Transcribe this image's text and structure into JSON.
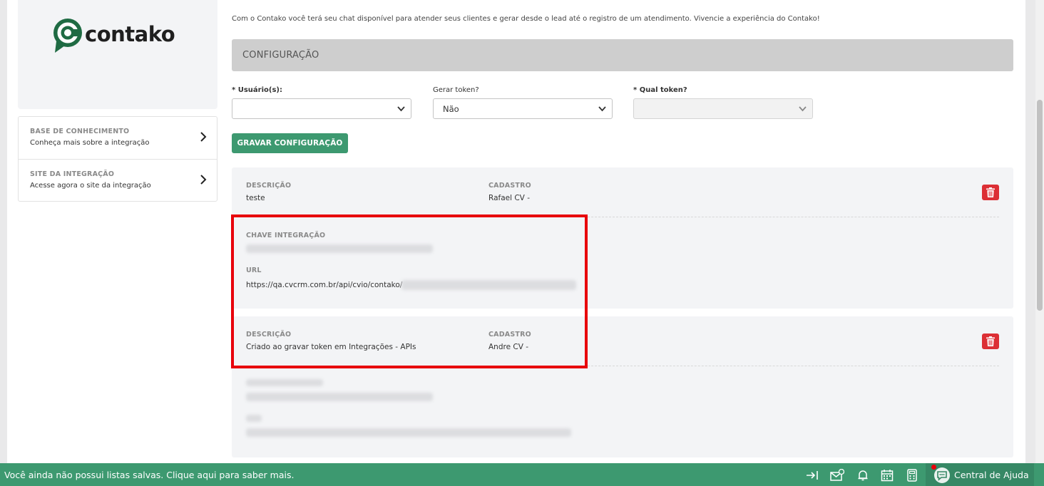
{
  "brand": {
    "name": "contako",
    "color": "#1f6b43"
  },
  "sidebar": {
    "links": [
      {
        "title": "BASE DE CONHECIMENTO",
        "subtitle": "Conheça mais sobre a integração"
      },
      {
        "title": "SITE DA INTEGRAÇÃO",
        "subtitle": "Acesse agora o site da integração"
      }
    ]
  },
  "main": {
    "intro": "Com o Contako você terá seu chat disponível para atender seus clientes e gerar desde o lead até o registro de um atendimento. Vivencie a experiência do Contako!",
    "section_title": "CONFIGURAÇÃO",
    "form": {
      "users_label": "* Usuário(s):",
      "users_value": "",
      "generate_token_label": "Gerar token?",
      "generate_token_value": "Não",
      "which_token_label": "* Qual token?",
      "which_token_value": "",
      "save_button": "GRAVAR CONFIGURAÇÃO"
    },
    "tokens": [
      {
        "description_label": "DESCRIÇÃO",
        "description": "teste",
        "created_label": "CADASTRO",
        "created": "Rafael CV -",
        "key_label": "CHAVE INTEGRAÇÃO",
        "url_label": "URL",
        "url_prefix": "https://qa.cvcrm.com.br/api/cvio/contako/"
      },
      {
        "description_label": "DESCRIÇÃO",
        "description": "Criado ao gravar token em Integrações - APIs",
        "created_label": "CADASTRO",
        "created": "Andre CV -"
      }
    ]
  },
  "footer": {
    "message": "Você ainda não possui listas salvas. Clique aqui para saber mais.",
    "help_label": "Central de Ajuda",
    "icons": [
      "collapse-icon",
      "mail-icon",
      "bell-icon",
      "calendar-icon",
      "calculator-icon"
    ],
    "color": "#3d9970"
  },
  "colors": {
    "accent": "#3d9970",
    "danger": "#dc2f35",
    "highlight": "#e8000b"
  }
}
